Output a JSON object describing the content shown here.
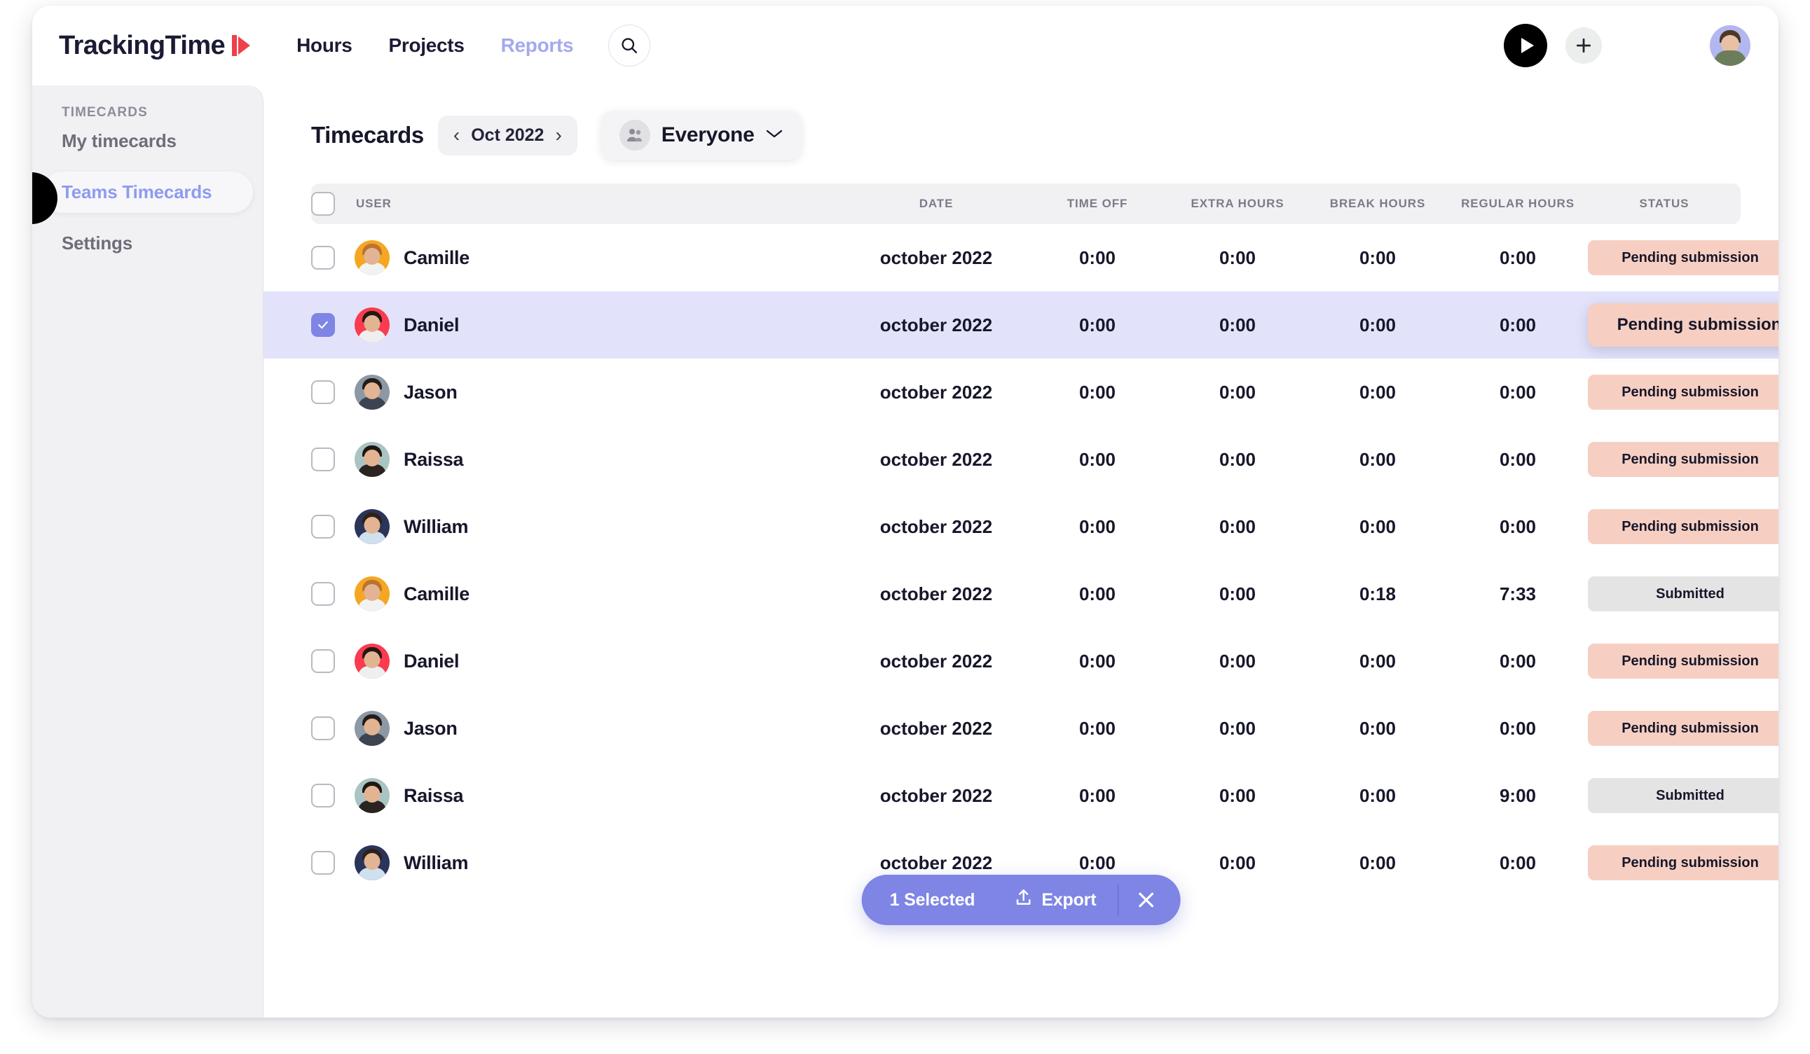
{
  "app": {
    "brand": "TrackingTime",
    "brand_logo_color": "#ef3f4a",
    "accent_color": "#7e85e4",
    "nav": [
      {
        "label": "Hours",
        "active": true
      },
      {
        "label": "Projects",
        "active": true
      },
      {
        "label": "Reports",
        "active": false
      }
    ],
    "search_icon": "search-icon",
    "play_icon": "play-icon",
    "add_icon": "plus-icon",
    "avatar_icon": "user-avatar"
  },
  "sidebar": {
    "section_title": "TIMECARDS",
    "items": [
      {
        "label": "My timecards",
        "active": false
      },
      {
        "label": "Teams Timecards",
        "active": true
      },
      {
        "label": "Settings",
        "active": false
      }
    ],
    "collapse_knob": "collapse-toggle"
  },
  "header": {
    "title": "Timecards",
    "prev_arrow": "‹",
    "month": "Oct 2022",
    "next_arrow": "›",
    "filter_label": "Everyone",
    "filter_icon": "people-group-icon",
    "filter_chevron": "chevron-down-icon"
  },
  "table": {
    "columns": [
      "USER",
      "DATE",
      "TIME OFF",
      "EXTRA HOURS",
      "BREAK HOURS",
      "REGULAR HOURS",
      "STATUS"
    ],
    "rows": [
      {
        "user": "Camille",
        "date": "october 2022",
        "time_off": "0:00",
        "extra_hours": "0:00",
        "break_hours": "0:00",
        "regular_hours": "0:00",
        "status": "Pending submission",
        "status_kind": "pending",
        "selected": false,
        "avatar_bg": "#f5a623",
        "hair": "#b9752f",
        "body": "#f2f2f2"
      },
      {
        "user": "Daniel",
        "date": "october 2022",
        "time_off": "0:00",
        "extra_hours": "0:00",
        "break_hours": "0:00",
        "regular_hours": "0:00",
        "status": "Pending submission",
        "status_kind": "pending",
        "selected": true,
        "avatar_bg": "#fb3b4e",
        "hair": "#241814",
        "body": "#efefef"
      },
      {
        "user": "Jason",
        "date": "october 2022",
        "time_off": "0:00",
        "extra_hours": "0:00",
        "break_hours": "0:00",
        "regular_hours": "0:00",
        "status": "Pending submission",
        "status_kind": "pending",
        "selected": false,
        "avatar_bg": "#8d98a6",
        "hair": "#241c18",
        "body": "#3b4450"
      },
      {
        "user": "Raissa",
        "date": "october 2022",
        "time_off": "0:00",
        "extra_hours": "0:00",
        "break_hours": "0:00",
        "regular_hours": "0:00",
        "status": "Pending submission",
        "status_kind": "pending",
        "selected": false,
        "avatar_bg": "#a9c4c2",
        "hair": "#1e1713",
        "body": "#2a2320"
      },
      {
        "user": "William",
        "date": "october 2022",
        "time_off": "0:00",
        "extra_hours": "0:00",
        "break_hours": "0:00",
        "regular_hours": "0:00",
        "status": "Pending submission",
        "status_kind": "pending",
        "selected": false,
        "avatar_bg": "#2b3459",
        "hair": "#2e2119",
        "body": "#cfe0ef"
      },
      {
        "user": "Camille",
        "date": "october 2022",
        "time_off": "0:00",
        "extra_hours": "0:00",
        "break_hours": "0:18",
        "regular_hours": "7:33",
        "status": "Submitted",
        "status_kind": "submitted",
        "selected": false,
        "avatar_bg": "#f5a623",
        "hair": "#b9752f",
        "body": "#f2f2f2"
      },
      {
        "user": "Daniel",
        "date": "october 2022",
        "time_off": "0:00",
        "extra_hours": "0:00",
        "break_hours": "0:00",
        "regular_hours": "0:00",
        "status": "Pending submission",
        "status_kind": "pending",
        "selected": false,
        "avatar_bg": "#fb3b4e",
        "hair": "#241814",
        "body": "#efefef"
      },
      {
        "user": "Jason",
        "date": "october 2022",
        "time_off": "0:00",
        "extra_hours": "0:00",
        "break_hours": "0:00",
        "regular_hours": "0:00",
        "status": "Pending submission",
        "status_kind": "pending",
        "selected": false,
        "avatar_bg": "#8d98a6",
        "hair": "#241c18",
        "body": "#3b4450"
      },
      {
        "user": "Raissa",
        "date": "october 2022",
        "time_off": "0:00",
        "extra_hours": "0:00",
        "break_hours": "0:00",
        "regular_hours": "9:00",
        "status": "Submitted",
        "status_kind": "submitted",
        "selected": false,
        "avatar_bg": "#a9c4c2",
        "hair": "#1e1713",
        "body": "#2a2320"
      },
      {
        "user": "William",
        "date": "october 2022",
        "time_off": "0:00",
        "extra_hours": "0:00",
        "break_hours": "0:00",
        "regular_hours": "0:00",
        "status": "Pending submission",
        "status_kind": "pending",
        "selected": false,
        "avatar_bg": "#2b3459",
        "hair": "#2e2119",
        "body": "#cfe0ef"
      }
    ],
    "status_colors": {
      "pending": "#f6cfc2",
      "submitted": "#e4e4e4"
    }
  },
  "action_bar": {
    "selected_label": "1 Selected",
    "export_label": "Export",
    "export_icon": "upload-icon",
    "close_icon": "close-icon",
    "background": "#7e85e4"
  }
}
